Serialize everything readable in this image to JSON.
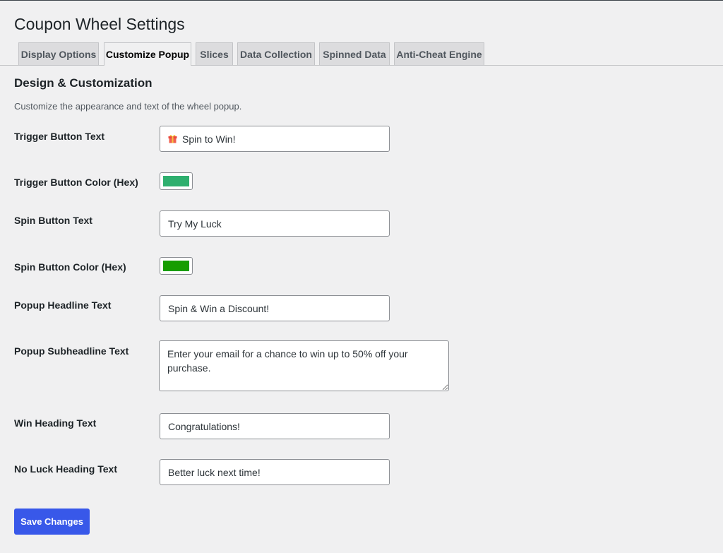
{
  "page": {
    "title": "Coupon Wheel Settings"
  },
  "tabs": [
    {
      "label": "Display Options"
    },
    {
      "label": "Customize Popup"
    },
    {
      "label": "Slices"
    },
    {
      "label": "Data Collection"
    },
    {
      "label": "Spinned Data"
    },
    {
      "label": "Anti-Cheat Engine"
    }
  ],
  "active_tab": "Customize Popup",
  "section": {
    "title": "Design & Customization",
    "description": "Customize the appearance and text of the wheel popup."
  },
  "fields": {
    "trigger_text": {
      "label": "Trigger Button Text",
      "value": "Spin to Win!",
      "icon": "gift-icon"
    },
    "trigger_color": {
      "label": "Trigger Button Color (Hex)",
      "value": "#2eaf6e"
    },
    "spin_text": {
      "label": "Spin Button Text",
      "value": "Try My Luck"
    },
    "spin_color": {
      "label": "Spin Button Color (Hex)",
      "value": "#179d00"
    },
    "headline": {
      "label": "Popup Headline Text",
      "value": "Spin & Win a Discount!"
    },
    "subheadline": {
      "label": "Popup Subheadline Text",
      "value": "Enter your email for a chance to win up to 50% off your purchase."
    },
    "win_heading": {
      "label": "Win Heading Text",
      "value": "Congratulations!"
    },
    "no_luck_heading": {
      "label": "No Luck Heading Text",
      "value": "Better luck next time!"
    }
  },
  "actions": {
    "save_label": "Save Changes"
  },
  "colors": {
    "accent": "#3858e9",
    "background": "#f0f0f1"
  }
}
